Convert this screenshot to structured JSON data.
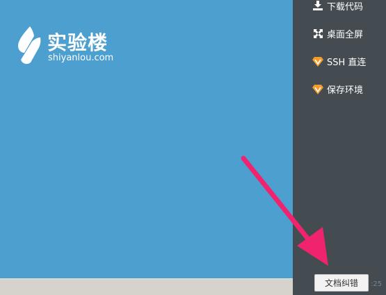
{
  "desktop": {
    "background_color": "#4c9fcf",
    "logo": {
      "title": "实验楼",
      "subtitle": "shiyanlou.com",
      "icon": "shiyanlou-logo-icon"
    }
  },
  "side_panel": {
    "background_color": "#444c52",
    "items": [
      {
        "label": "下载代码",
        "icon": "download-icon"
      },
      {
        "label": "桌面全屏",
        "icon": "fullscreen-icon"
      },
      {
        "label": "SSH 直连",
        "icon": "vip-gem-icon"
      },
      {
        "label": "保存环境",
        "icon": "vip-gem-icon"
      }
    ]
  },
  "feedback_button": {
    "label": "文档纠错"
  },
  "clock": {
    "partial_text": ":25"
  },
  "annotation": {
    "arrow_color": "#f0246e",
    "icon": "pointer-arrow"
  }
}
